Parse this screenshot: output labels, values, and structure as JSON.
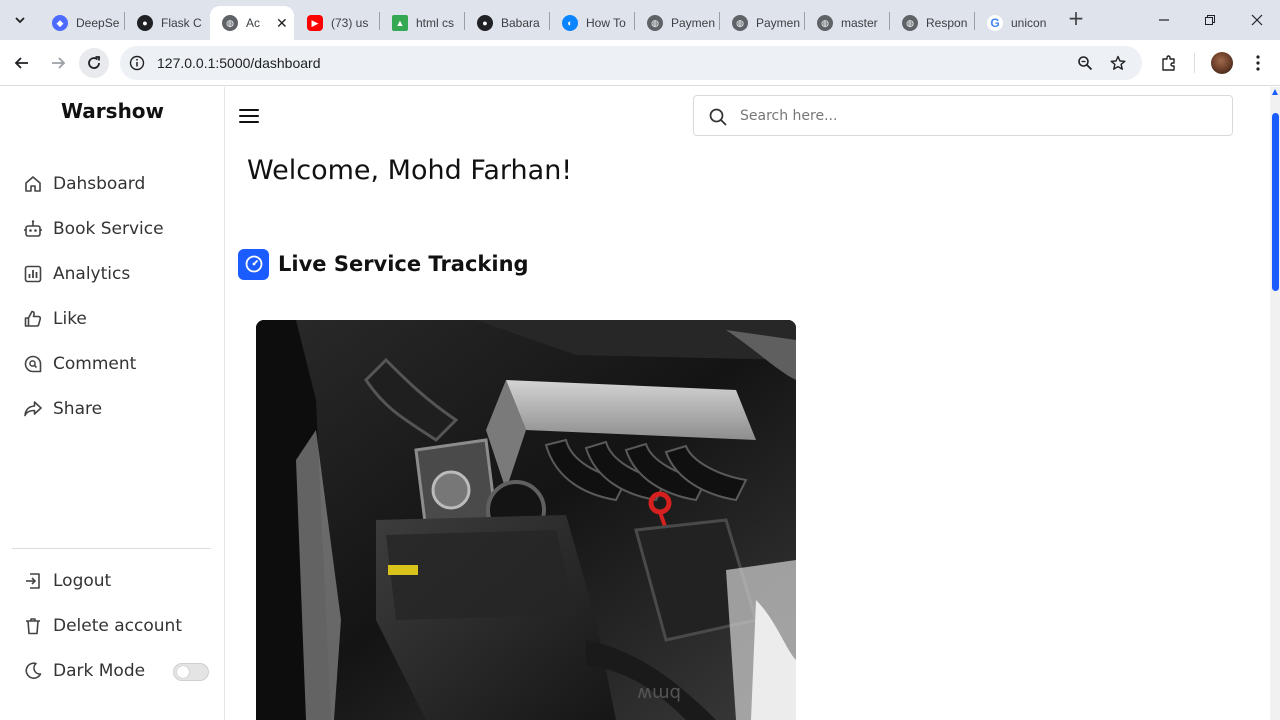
{
  "browser": {
    "tabs": [
      {
        "title": "DeepSe",
        "icon": "deepseek-icon",
        "color": "#4d6bfe"
      },
      {
        "title": "Flask C",
        "icon": "flask-icon",
        "color": "#202124"
      },
      {
        "title": "Ac",
        "icon": "globe-icon",
        "color": "#5f6368"
      },
      {
        "title": "(73) us",
        "icon": "youtube-icon",
        "color": "#ff0000"
      },
      {
        "title": "html cs",
        "icon": "google-drive-icon",
        "color": "#34a853"
      },
      {
        "title": "Babara",
        "icon": "github-icon",
        "color": "#202124"
      },
      {
        "title": "How To",
        "icon": "codeium-icon",
        "color": "#0a84ff"
      },
      {
        "title": "Paymen",
        "icon": "globe-icon",
        "color": "#5f6368"
      },
      {
        "title": "Paymen",
        "icon": "globe-icon",
        "color": "#5f6368"
      },
      {
        "title": "master",
        "icon": "globe-icon",
        "color": "#5f6368"
      },
      {
        "title": "Respon",
        "icon": "globe-icon",
        "color": "#5f6368"
      },
      {
        "title": "unicon",
        "icon": "google-icon",
        "color": "#4285f4"
      }
    ],
    "url": "127.0.0.1:5000/dashboard"
  },
  "sidebar": {
    "brand": "Warshow",
    "items": [
      {
        "label": "Dahsboard",
        "icon": "home-icon"
      },
      {
        "label": "Book Service",
        "icon": "robot-icon"
      },
      {
        "label": "Analytics",
        "icon": "bar-chart-icon"
      },
      {
        "label": "Like",
        "icon": "thumbs-up-icon"
      },
      {
        "label": "Comment",
        "icon": "comment-search-icon"
      },
      {
        "label": "Share",
        "icon": "share-icon"
      }
    ],
    "bottom": [
      {
        "label": "Logout",
        "icon": "logout-icon"
      },
      {
        "label": "Delete account",
        "icon": "trash-icon"
      },
      {
        "label": "Dark Mode",
        "icon": "moon-icon"
      }
    ]
  },
  "search": {
    "placeholder": "Search here..."
  },
  "main": {
    "welcome": "Welcome, Mohd Farhan!",
    "section_title": "Live Service Tracking",
    "image_alt": "engine-bay-photo"
  },
  "colors": {
    "accent": "#1a5cff",
    "text": "#111111"
  }
}
